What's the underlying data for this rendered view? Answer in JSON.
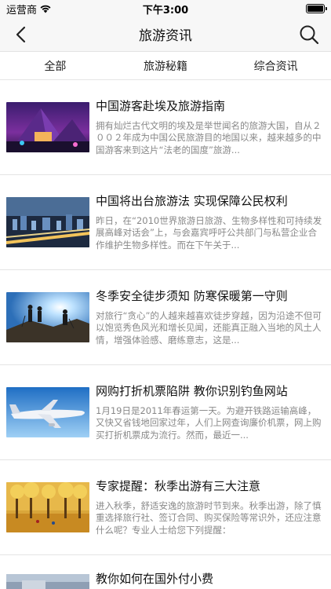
{
  "status": {
    "carrier": "运营商",
    "time": "下午3:00"
  },
  "nav": {
    "title": "旅游资讯"
  },
  "tabs": [
    {
      "label": "全部"
    },
    {
      "label": "旅游秘籍"
    },
    {
      "label": "综合资讯"
    }
  ],
  "articles": [
    {
      "title": "中国游客赴埃及旅游指南",
      "summary": "拥有灿烂古代文明的埃及是举世闻名的旅游大国，自从２００２年成为中国公民旅游目的地国以来，越来越多的中国游客来到这片“法老的国度”旅游..."
    },
    {
      "title": "中国将出台旅游法 实现保障公民权利",
      "summary": "昨日，在“2010世界旅游日旅游、生物多样性和可持续发展高峰对话会”上，与会嘉宾呼吁公共部门与私营企业合作维护生物多样性。而在下午关于..."
    },
    {
      "title": "冬季安全徒步须知 防寒保暖第一守则",
      "summary": "对旅行“贪心”的人越来越喜欢徒步穿越，因为沿途不但可以饱览秀色风光和增长见闻，还能真正融入当地的风土人情，增强体验感、磨练意志，这是..."
    },
    {
      "title": "网购打折机票陷阱 教你识别钓鱼网站",
      "summary": "1月19日是2011年春运第一天。为避开铁路运输高峰，又快又省钱地回家过年，人们上网查询廉价机票，网上购买打折机票成为流行。然而，最近一..."
    },
    {
      "title": "专家提醒：秋季出游有三大注意",
      "summary": "进入秋季，舒适安逸的旅游时节到来。秋季出游，除了慎重选择旅行社、签订合同、购买保险等常识外，还应注意什么呢？专业人士给您下列提醒："
    },
    {
      "title": "教你如何在国外付小费",
      "summary": ""
    }
  ]
}
